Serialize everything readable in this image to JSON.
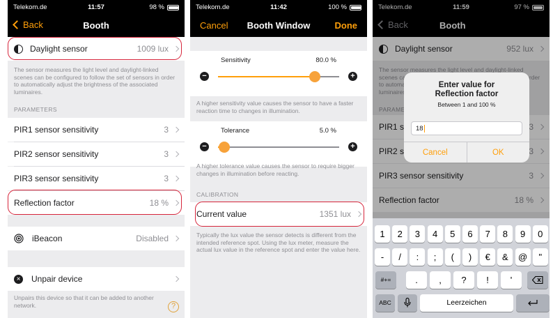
{
  "status": [
    {
      "carrier": "Telekom.de",
      "time": "11:57",
      "battery": "98 %",
      "level": 0.98
    },
    {
      "carrier": "Telekom.de",
      "time": "11:42",
      "battery": "100 %",
      "level": 1.0
    },
    {
      "carrier": "Telekom.de",
      "time": "11:59",
      "battery": "97 %",
      "level": 0.97
    }
  ],
  "screen1": {
    "back": "Back",
    "title": "Booth",
    "daylight": {
      "label": "Daylight sensor",
      "value": "1009 lux"
    },
    "description": "The sensor measures the light level and daylight-linked scenes can be configured to follow the set of sensors in order to automatically adjust the brightness of the associated luminaires.",
    "parameters_header": "PARAMETERS",
    "rows": [
      {
        "label": "PIR1 sensor sensitivity",
        "value": "3"
      },
      {
        "label": "PIR2 sensor sensitivity",
        "value": "3"
      },
      {
        "label": "PIR3 sensor sensitivity",
        "value": "3"
      },
      {
        "label": "Reflection factor",
        "value": "18 %"
      }
    ],
    "ibeacon": {
      "label": "iBeacon",
      "value": "Disabled"
    },
    "unpair": {
      "label": "Unpair device",
      "note": "Unpairs this device so that it can be added to another network."
    },
    "help": "?"
  },
  "screen2": {
    "cancel": "Cancel",
    "title": "Booth Window",
    "done": "Done",
    "sensitivity": {
      "label": "Sensitivity",
      "value": "80.0 %",
      "level": 0.8,
      "note": "A higher sensitivity value causes the sensor to have a faster reaction time to changes in illumination."
    },
    "tolerance": {
      "label": "Tolerance",
      "value": "5.0 %",
      "level": 0.05,
      "note": "A higher tolerance value causes the sensor to require bigger changes in illumination before reacting."
    },
    "calibration_header": "CALIBRATION",
    "current": {
      "label": "Current value",
      "value": "1351 lux"
    },
    "calibration_note": "Typically the lux value the sensor detects is different from the intended reference spot. Using the lux meter, measure the actual lux value in the reference spot and enter the value here."
  },
  "screen3": {
    "back": "Back",
    "title": "Booth",
    "daylight": {
      "label": "Daylight sensor",
      "value": "952 lux"
    },
    "description": "The sensor measures the light level and daylight-linked scenes can be configured to follow the set of sensors in order to automatically adjust the brightness of the associated luminaires.",
    "parameters_header": "PARAMETERS",
    "rows": [
      {
        "label": "PIR1 sensor sensitivity",
        "value": "3"
      },
      {
        "label": "PIR2 sensor sensitivity",
        "value": "3"
      },
      {
        "label": "PIR3 sensor sensitivity",
        "value": "3"
      },
      {
        "label": "Reflection factor",
        "value": "18 %"
      }
    ],
    "alert": {
      "title_line1": "Enter value for",
      "title_line2": "Reflection factor",
      "message": "Between 1 and 100 %",
      "input_value": "18",
      "cancel": "Cancel",
      "ok": "OK"
    },
    "keyboard": {
      "row1": [
        "1",
        "2",
        "3",
        "4",
        "5",
        "6",
        "7",
        "8",
        "9",
        "0"
      ],
      "row2": [
        "-",
        "/",
        ":",
        ";",
        "(",
        ")",
        "€",
        "&",
        "@",
        "\""
      ],
      "row3": [
        ".",
        ",",
        "?",
        "!",
        "'"
      ],
      "symbols": "#+=",
      "abc": "ABC",
      "space": "Leerzeichen"
    }
  },
  "colors": {
    "accent": "#ff9f0a",
    "highlight": "#d6243a",
    "background": "#ececee"
  }
}
